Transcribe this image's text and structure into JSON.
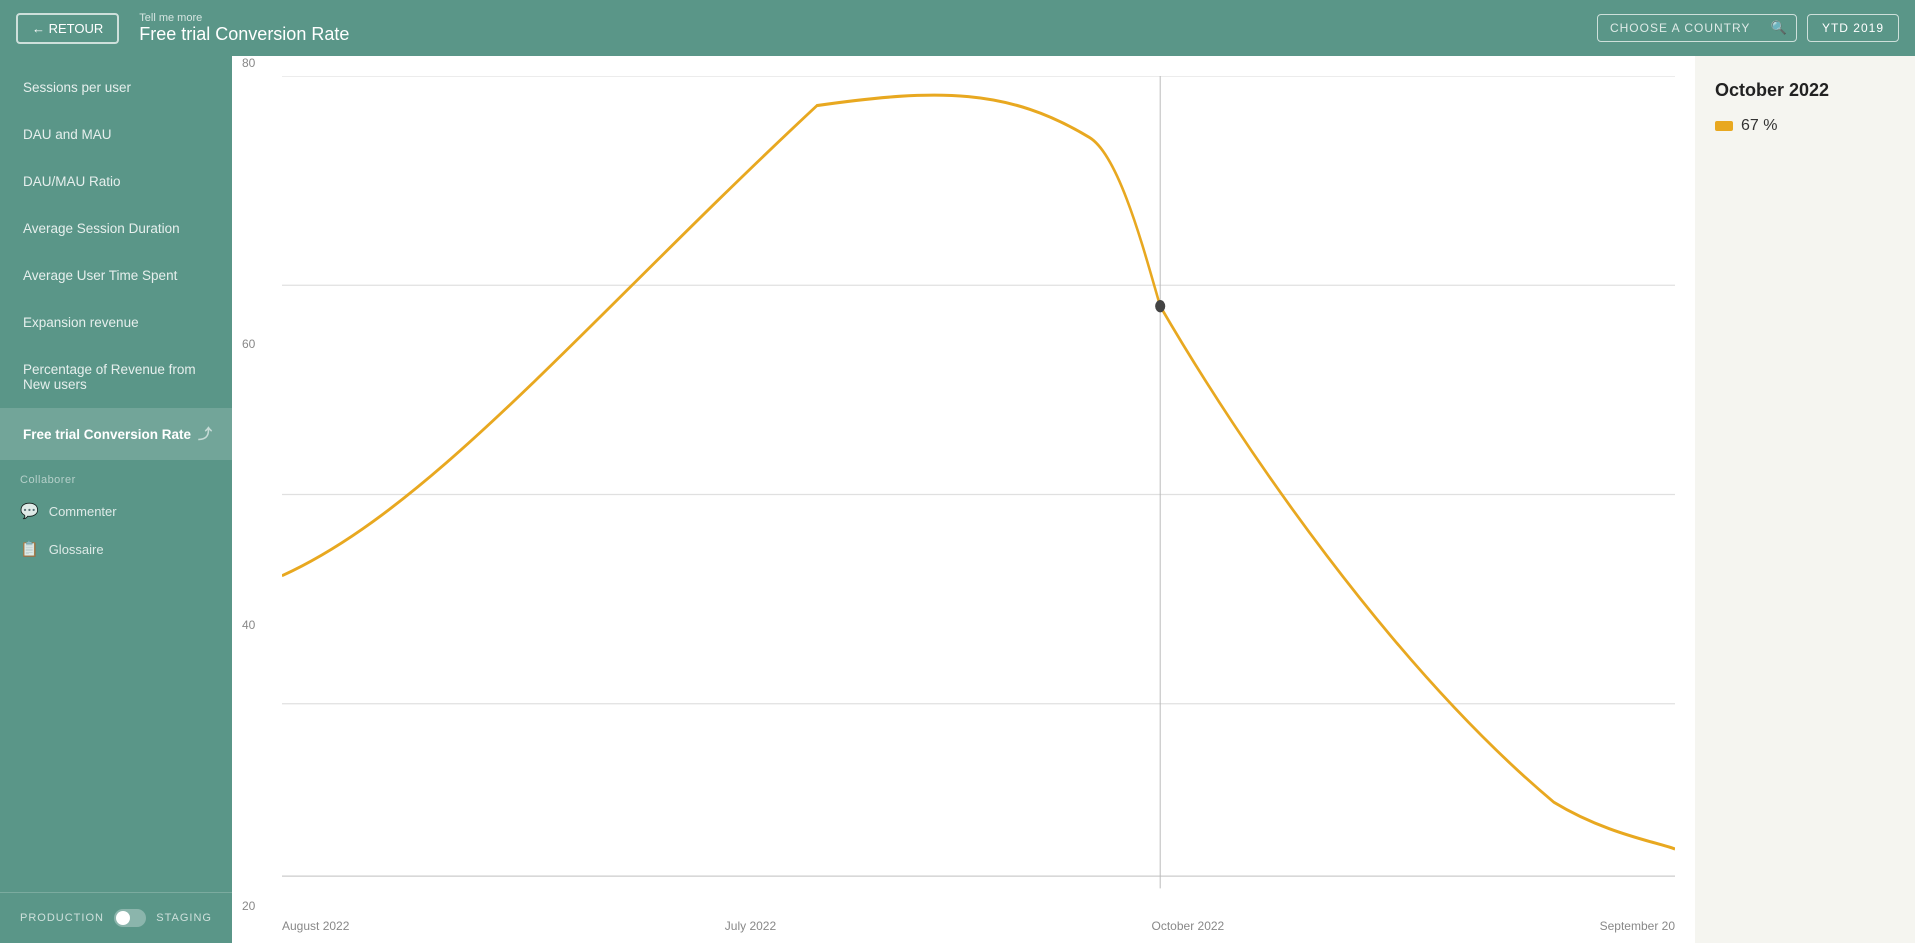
{
  "topbar": {
    "back_label": "← RETOUR",
    "subtitle": "Tell me more",
    "title": "Free trial Conversion Rate",
    "country_placeholder": "CHOOSE A COUNTRY",
    "ytd_label": "YTD 2019"
  },
  "sidebar": {
    "items": [
      {
        "id": "sessions-per-user",
        "label": "Sessions per user",
        "active": false
      },
      {
        "id": "dau-mau",
        "label": "DAU and MAU",
        "active": false
      },
      {
        "id": "dau-mau-ratio",
        "label": "DAU/MAU Ratio",
        "active": false
      },
      {
        "id": "avg-session-duration",
        "label": "Average Session Duration",
        "active": false
      },
      {
        "id": "avg-user-time",
        "label": "Average User Time Spent",
        "active": false
      },
      {
        "id": "expansion-revenue",
        "label": "Expansion revenue",
        "active": false
      },
      {
        "id": "pct-revenue-new-users",
        "label": "Percentage of Revenue from New users",
        "active": false
      },
      {
        "id": "free-trial-conversion",
        "label": "Free trial Conversion Rate",
        "active": true
      }
    ],
    "section_label": "Collaborer",
    "collaborer_items": [
      {
        "id": "commenter",
        "label": "Commenter",
        "icon": "💬"
      },
      {
        "id": "glossaire",
        "label": "Glossaire",
        "icon": "📋"
      }
    ],
    "footer": {
      "production_label": "PRODUCTION",
      "staging_label": "STAGING"
    }
  },
  "chart": {
    "title": "Free trial Conversion Rate",
    "y_labels": [
      "80",
      "60",
      "40",
      "20"
    ],
    "x_labels": [
      "August 2022",
      "July 2022",
      "October 2022",
      "September 20"
    ],
    "data_point_label": "October 2022",
    "data_point_value": "67"
  },
  "right_panel": {
    "month": "October 2022",
    "metric_value": "67 %",
    "metric_color": "#e8a820"
  }
}
